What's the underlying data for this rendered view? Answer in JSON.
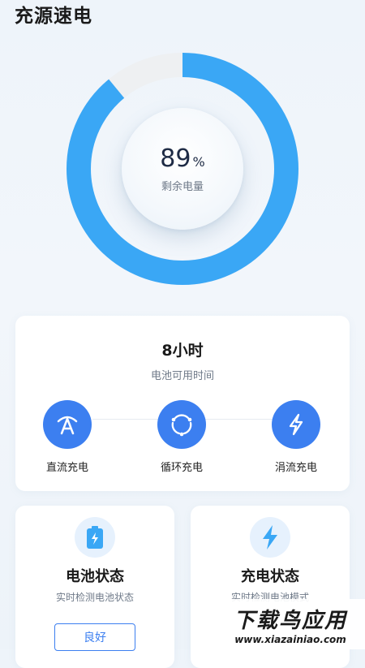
{
  "app": {
    "title": "充源速电"
  },
  "battery": {
    "percent_value": "89",
    "percent_unit": "%",
    "label": "剩余电量",
    "level": 0.89
  },
  "colors": {
    "accent": "#3AA7F5",
    "track": "#EEF0F2",
    "primary": "#3C7FF0"
  },
  "usage": {
    "time_value": "8小时",
    "time_label": "电池可用时间",
    "modes": [
      {
        "icon": "direct-charge-icon",
        "label": "直流充电"
      },
      {
        "icon": "cycle-charge-icon",
        "label": "循环充电"
      },
      {
        "icon": "trickle-charge-icon",
        "label": "涓流充电"
      }
    ]
  },
  "status_cards": [
    {
      "icon": "battery-icon",
      "title": "电池状态",
      "subtitle": "实时检测电池状态",
      "button": "良好"
    },
    {
      "icon": "lightning-icon",
      "title": "充电状态",
      "subtitle": "实时检测电池模式"
    }
  ],
  "watermark": {
    "line1": "下载鸟应用",
    "line2": "www.xiazainiao.com"
  }
}
